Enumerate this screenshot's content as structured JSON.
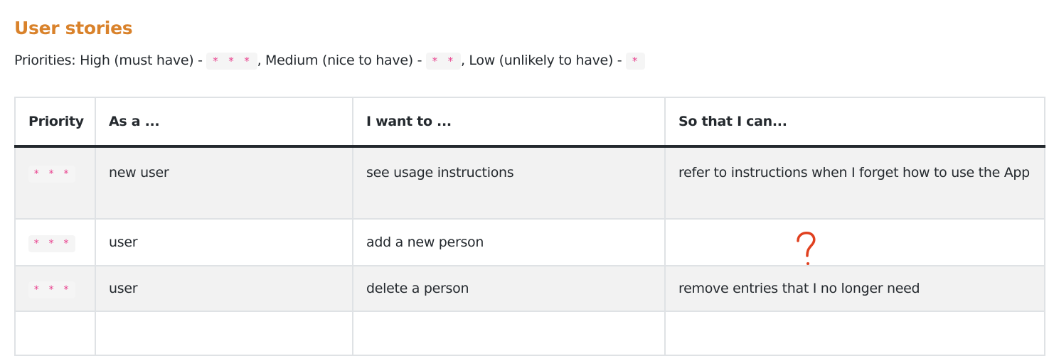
{
  "heading": "User stories",
  "priorities": {
    "prefix": "Priorities: High (must have) - ",
    "high_code": "* * *",
    "medium_text": ", Medium (nice to have) - ",
    "medium_code": "* *",
    "low_text": ", Low (unlikely to have) - ",
    "low_code": "*"
  },
  "table": {
    "headers": [
      "Priority",
      "As a ...",
      "I want to ...",
      "So that I can..."
    ],
    "rows": [
      {
        "priority": "* * *",
        "as_a": "new user",
        "want": "see usage instructions",
        "so_that": "refer to instructions when I forget how to use the App"
      },
      {
        "priority": "* * *",
        "as_a": "user",
        "want": "add a new person",
        "so_that": ""
      },
      {
        "priority": "* * *",
        "as_a": "user",
        "want": "delete a person",
        "so_that": "remove entries that I no longer need"
      },
      {
        "priority": "",
        "as_a": "",
        "want": "",
        "so_that": ""
      }
    ]
  },
  "annotation": {
    "mark": "question-mark",
    "color": "#e0401f"
  }
}
